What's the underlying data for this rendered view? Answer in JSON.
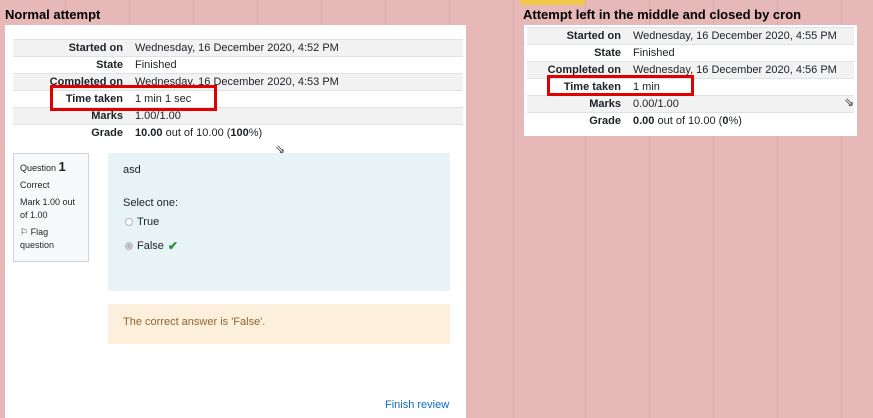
{
  "left": {
    "heading": "Normal attempt",
    "rows": [
      {
        "label": "Started on",
        "value": "Wednesday, 16 December 2020, 4:52 PM"
      },
      {
        "label": "State",
        "value": "Finished"
      },
      {
        "label": "Completed on",
        "value": "Wednesday, 16 December 2020, 4:53 PM"
      },
      {
        "label": "Time taken",
        "value": "1 min 1 sec"
      },
      {
        "label": "Marks",
        "value": "1.00/1.00"
      }
    ],
    "grade": {
      "label": "Grade",
      "score": "10.00",
      "mid": " out of 10.00 (",
      "pct": "100",
      "end": "%)"
    },
    "question": {
      "prefix": "Question",
      "number": "1",
      "status": "Correct",
      "mark": "Mark 1.00 out of 1.00",
      "flag": "Flag question",
      "text": "asd",
      "prompt": "Select one:",
      "options": [
        "True",
        "False"
      ],
      "feedback": "The correct answer is 'False'."
    },
    "finish_link": "Finish review"
  },
  "right": {
    "heading": "Attempt left in the middle and closed by cron",
    "rows": [
      {
        "label": "Started on",
        "value": "Wednesday, 16 December 2020, 4:55 PM"
      },
      {
        "label": "State",
        "value": "Finished"
      },
      {
        "label": "Completed on",
        "value": "Wednesday, 16 December 2020, 4:56 PM"
      },
      {
        "label": "Time taken",
        "value": "1 min"
      },
      {
        "label": "Marks",
        "value": "0.00/1.00"
      }
    ],
    "grade": {
      "label": "Grade",
      "score": "0.00",
      "mid": " out of 10.00 (",
      "pct": "0",
      "end": "%)"
    }
  },
  "colors": {
    "highlight_box": "#e00000",
    "sheet_background": "#e6b8b7",
    "correct_check": "#2e8b39"
  },
  "icons": {
    "flag": "flag-icon",
    "check": "check-icon",
    "cursor": "mouse-cursor-icon"
  }
}
